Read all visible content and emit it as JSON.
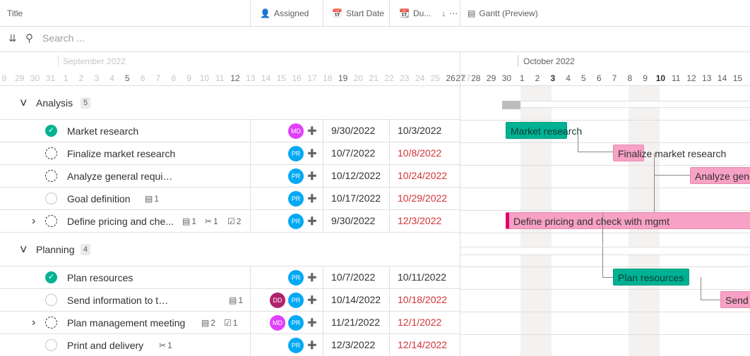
{
  "header": {
    "title": "Title",
    "assigned": "Assigned",
    "start": "Start Date",
    "due": "Du...",
    "gantt": "Gantt (Preview)"
  },
  "search": {
    "placeholder": "Search ..."
  },
  "timeline": {
    "sep_month": "September 2022",
    "oct_month": "October 2022",
    "left_days": [
      "8",
      "29",
      "30",
      "31",
      "1",
      "2",
      "3",
      "4",
      "5",
      "6",
      "7",
      "8",
      "9",
      "10",
      "11",
      "12",
      "13",
      "14",
      "15",
      "16",
      "17",
      "18",
      "19",
      "20",
      "21",
      "22",
      "23",
      "24",
      "25",
      "26",
      "27"
    ],
    "right_days": [
      "27",
      "28",
      "29",
      "30",
      "1",
      "2",
      "3",
      "4",
      "5",
      "6",
      "7",
      "8",
      "9",
      "10",
      "11",
      "12",
      "13",
      "14",
      "15"
    ]
  },
  "groups": [
    {
      "name": "Analysis",
      "count": "5",
      "tasks": [
        {
          "title": "Market research",
          "status": "done",
          "avatars": [
            "MD"
          ],
          "start": "9/30/2022",
          "due": "10/3/2022",
          "due_red": false
        },
        {
          "title": "Finalize market research",
          "status": "progress",
          "avatars": [
            "PR"
          ],
          "start": "10/7/2022",
          "due": "10/8/2022",
          "due_red": true
        },
        {
          "title": "Analyze general requirements",
          "status": "progress",
          "avatars": [
            "PR"
          ],
          "start": "10/12/2022",
          "due": "10/24/2022",
          "due_red": true
        },
        {
          "title": "Goal definition",
          "status": "todo",
          "comments": "1",
          "avatars": [
            "PR"
          ],
          "start": "10/17/2022",
          "due": "10/29/2022",
          "due_red": true
        },
        {
          "title": "Define pricing and che...",
          "status": "progress",
          "expand": true,
          "comments": "1",
          "attach": "1",
          "checks": "2",
          "avatars": [
            "PR"
          ],
          "start": "9/30/2022",
          "due": "12/3/2022",
          "due_red": true
        }
      ]
    },
    {
      "name": "Planning",
      "count": "4",
      "tasks": [
        {
          "title": "Plan resources",
          "status": "done",
          "avatars": [
            "PR"
          ],
          "start": "10/7/2022",
          "due": "10/11/2022",
          "due_red": false
        },
        {
          "title": "Send information to team memb...",
          "status": "todo",
          "comments": "1",
          "avatars": [
            "DD",
            "PR"
          ],
          "start": "10/14/2022",
          "due": "10/18/2022",
          "due_red": true
        },
        {
          "title": "Plan management meeting",
          "status": "progress",
          "expand": true,
          "comments": "2",
          "checks": "1",
          "avatars": [
            "MD",
            "PR"
          ],
          "start": "11/21/2022",
          "due": "12/1/2022",
          "due_red": true
        },
        {
          "title": "Print and delivery",
          "status": "todo",
          "attach": "1",
          "avatars": [
            "PR"
          ],
          "start": "12/3/2022",
          "due": "12/14/2022",
          "due_red": true
        }
      ]
    }
  ],
  "bars": {
    "market": "Market research",
    "finalize": "Finalize market research",
    "analyze": "Analyze gene",
    "define": "Define pricing and check with mgmt",
    "plan": "Plan resources",
    "send": "Send i"
  },
  "colors": {
    "MD": "#e040fb",
    "PR": "#03a9f4",
    "DD": "#b0226a",
    "green": "#00b294",
    "pink": "#f7a1c4"
  }
}
